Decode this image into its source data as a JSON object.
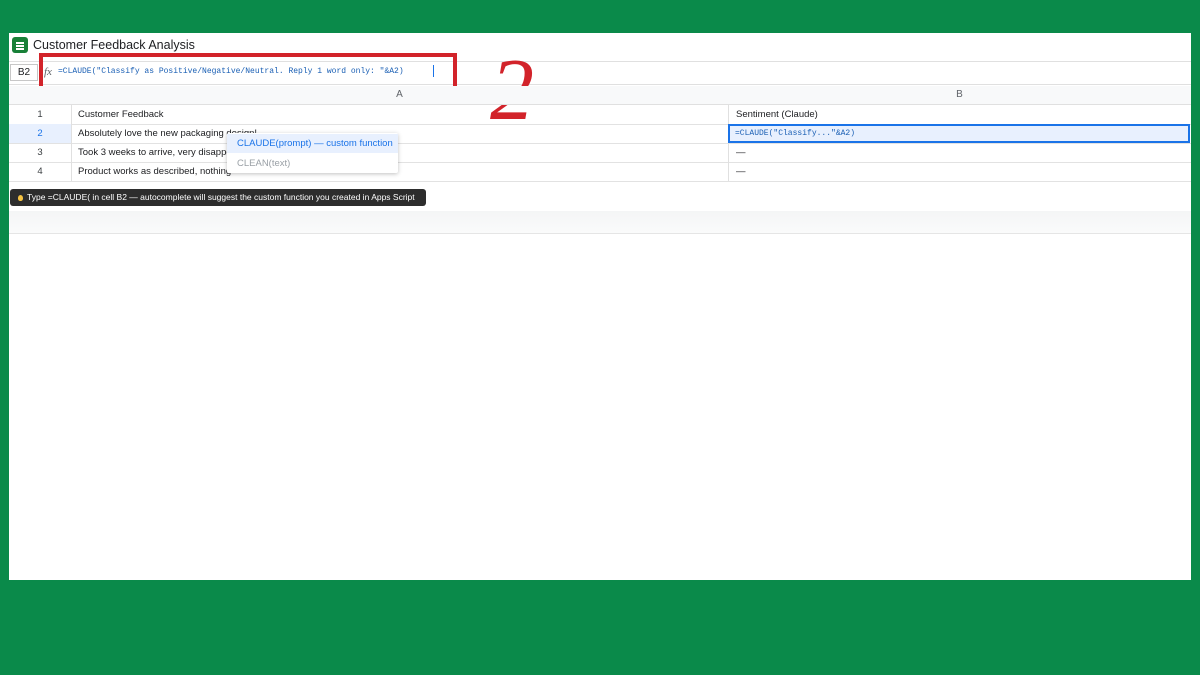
{
  "title": "Customer Feedback Analysis",
  "formula_bar": {
    "cell_ref": "B2",
    "fx_label": "fx",
    "formula": "=CLAUDE(\"Classify as Positive/Negative/Neutral. Reply 1 word only: \"&A2)"
  },
  "annotation": {
    "step_number": "2"
  },
  "columns": {
    "a": "A",
    "b": "B"
  },
  "rows": [
    {
      "num": "1",
      "a": "Customer Feedback",
      "b": "Sentiment (Claude)"
    },
    {
      "num": "2",
      "a": "Absolutely love the new packaging design!",
      "b": "=CLAUDE(\"Classify...\"&A2)"
    },
    {
      "num": "3",
      "a": "Took 3 weeks to arrive, very disappo",
      "b": "—"
    },
    {
      "num": "4",
      "a": "Product works as described, nothing",
      "b": "—"
    }
  ],
  "autocomplete": {
    "items": [
      "CLAUDE(prompt) — custom function",
      "CLEAN(text)"
    ]
  },
  "tip": "Type =CLAUDE( in cell B2 — autocomplete will suggest the custom function you created in Apps Script",
  "colors": {
    "background": "#0a8a4a",
    "accent": "#1a73e8",
    "annotation": "#d2232a"
  }
}
